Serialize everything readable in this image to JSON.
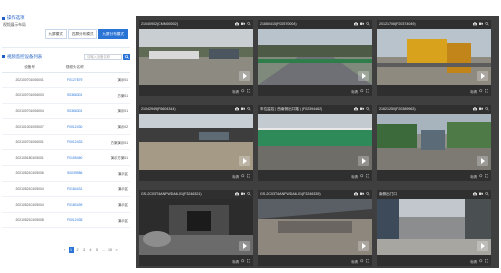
{
  "left": {
    "section1_title": "操作选项",
    "layer_label": "视频展示布局",
    "tabs": [
      "九屏模式",
      "四屏分布模式",
      "九屏分布模式"
    ],
    "active_tab": 2,
    "section2_title": "视频监控设备列表",
    "search_placeholder": "请输入设备名称",
    "columns": [
      "设备号",
      "视频头名称",
      ""
    ],
    "rows": [
      [
        "202100701006001",
        "F0127879",
        "演示01"
      ],
      [
        "202100701006003",
        "S0366301",
        "方案01"
      ],
      [
        "202100701006004",
        "S0366301",
        "演示01"
      ],
      [
        "202101001005007",
        "F0012430",
        "演示02"
      ],
      [
        "202100701006001",
        "F0012433",
        "方案演示01"
      ],
      [
        "202105180105001",
        "F0159460",
        "演示方案01"
      ],
      [
        "202105210105006",
        "S0039986",
        "演示区"
      ],
      [
        "202105210105004",
        "F0184431",
        "演示区"
      ],
      [
        "202105210105004",
        "F0180439",
        "演示区"
      ],
      [
        "202105210105008",
        "F0012435",
        "演示区"
      ]
    ],
    "pager": [
      "1",
      "2",
      "3",
      "4",
      "5",
      "...",
      "15",
      ">"
    ]
  },
  "grid": {
    "cells": [
      {
        "title": "21040902(CMM00002)",
        "quality": "标清",
        "scene": "site-fence"
      },
      {
        "title": "21650410(F02570004)",
        "quality": "标清",
        "scene": "road-green"
      },
      {
        "title": "20121706(F20374049)",
        "quality": "标清",
        "scene": "crane"
      },
      {
        "title": "21042949(F6604344)",
        "quality": "标清",
        "scene": "wall-dirt"
      },
      {
        "title": "车位监控 | 西南侧出口路 | (F02394462)",
        "quality": "标清",
        "scene": "green-fence"
      },
      {
        "title": "21621250(F20389963)",
        "quality": "标清",
        "scene": "trees"
      },
      {
        "title": "GS-2C03T4ANFWDA6-01(F3246321)",
        "quality": "标清",
        "scene": "tunnel"
      },
      {
        "title": "GS-2C03T4ANFWDA6-01(F3246339)",
        "quality": "标清",
        "scene": "shed"
      },
      {
        "title": "南侧出门口",
        "quality": "标清",
        "scene": "yard"
      }
    ]
  },
  "colors": {
    "accent": "#2a74d6",
    "grid_bg": "#3f3f3f"
  }
}
